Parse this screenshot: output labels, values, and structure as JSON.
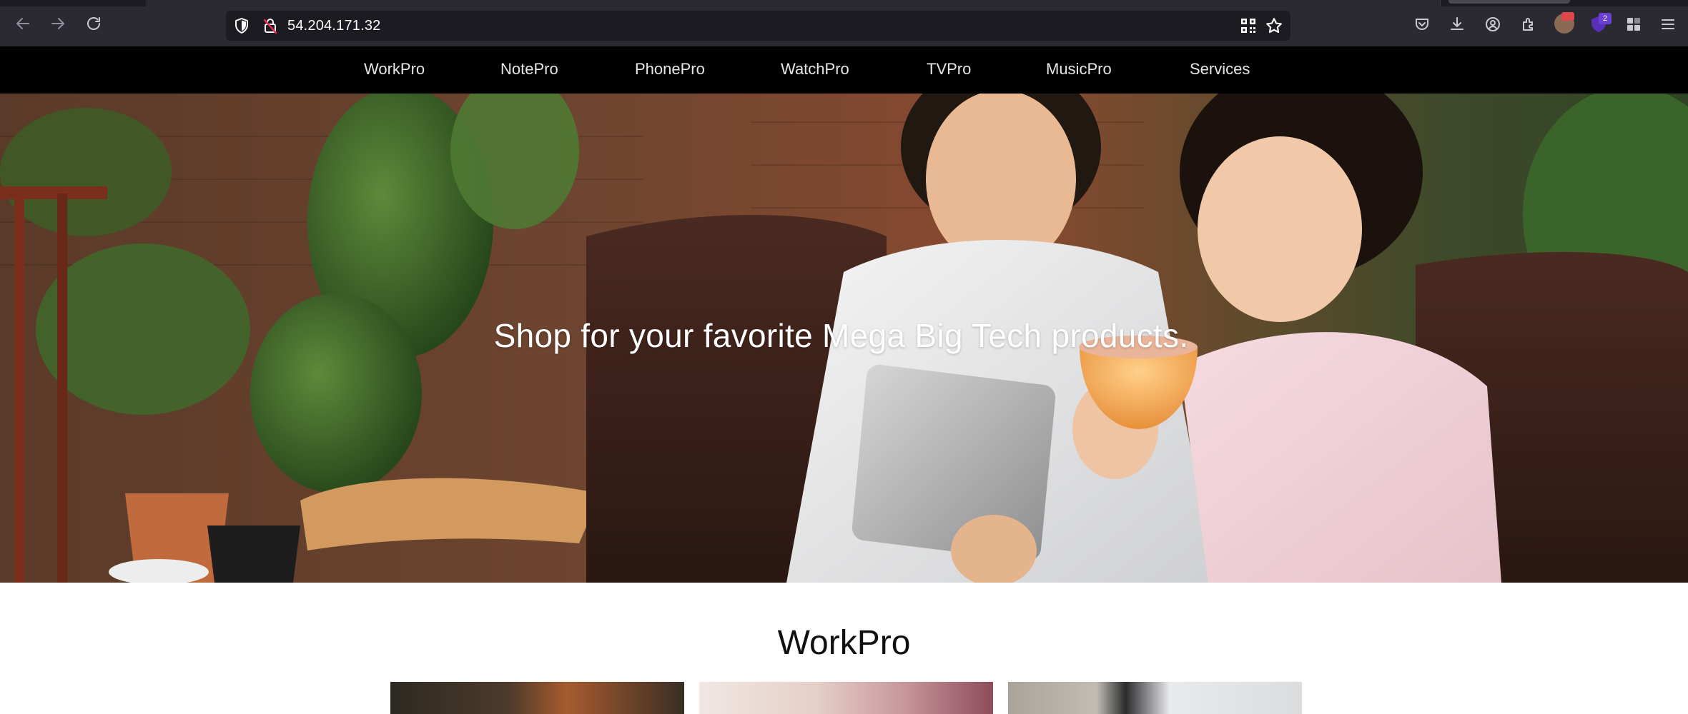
{
  "browser": {
    "url": "54.204.171.32",
    "extension_badge_count": "2",
    "icons": {
      "back": "arrow-left-icon",
      "forward": "arrow-right-icon",
      "reload": "reload-icon",
      "tracking": "shield-icon",
      "insecure": "lock-warning-icon",
      "qr": "qr-code-icon",
      "bookmark": "star-icon",
      "pocket": "pocket-icon",
      "downloads": "download-icon",
      "account": "account-icon",
      "extensions": "puzzle-icon",
      "menu": "hamburger-menu-icon"
    }
  },
  "nav": {
    "items": [
      "WorkPro",
      "NotePro",
      "PhonePro",
      "WatchPro",
      "TVPro",
      "MusicPro",
      "Services"
    ]
  },
  "hero": {
    "headline": "Shop for your favorite Mega Big Tech products."
  },
  "section": {
    "title": "WorkPro"
  },
  "colors": {
    "chrome_bg": "#2b2a33",
    "url_bg": "#1c1b22",
    "nav_bg": "#000000",
    "nav_text": "#e6e6e6",
    "page_bg": "#ffffff"
  }
}
